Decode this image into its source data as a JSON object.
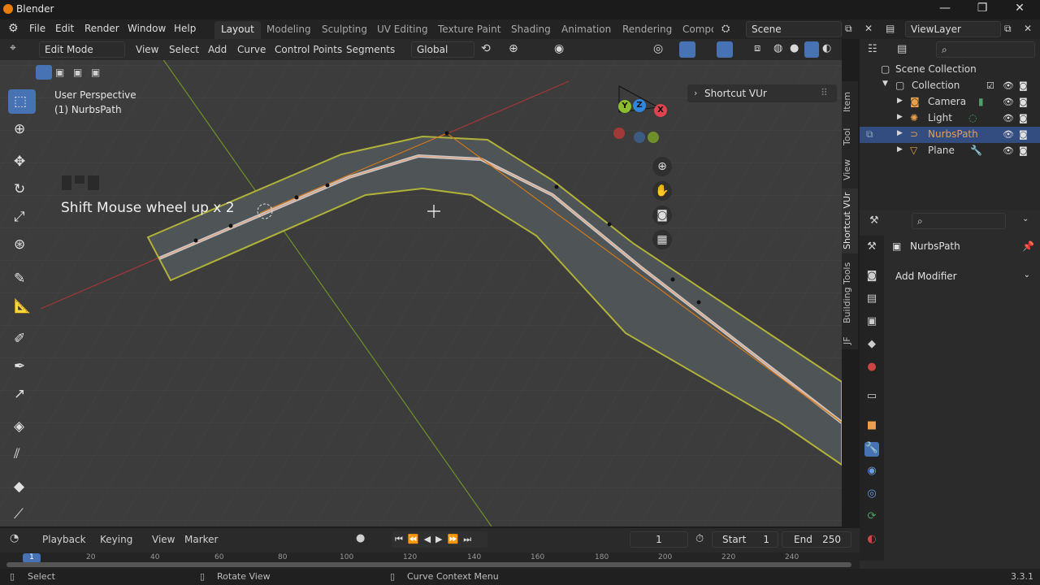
{
  "window": {
    "title": "Blender",
    "controls": [
      "—",
      "❐",
      "✕"
    ]
  },
  "menu": {
    "items": [
      "File",
      "Edit",
      "Render",
      "Window",
      "Help"
    ]
  },
  "workspaces": {
    "tabs": [
      "Layout",
      "Modeling",
      "Sculpting",
      "UV Editing",
      "Texture Paint",
      "Shading",
      "Animation",
      "Rendering",
      "Compo"
    ],
    "active": "Layout"
  },
  "scene": {
    "name": "Scene"
  },
  "viewlayer": {
    "name": "ViewLayer"
  },
  "header": {
    "mode": "Edit Mode",
    "menus": [
      "View",
      "Select",
      "Add",
      "Curve",
      "Control Points",
      "Segments"
    ],
    "transform": "Global"
  },
  "viewport": {
    "perspective": "User Perspective",
    "object": "(1) NurbsPath",
    "overlay_text": "Shift Mouse wheel up x 2",
    "panel": "Shortcut VUr",
    "gizmo": {
      "x": "X",
      "y": "Y",
      "z": "Z"
    }
  },
  "sidebar_tabs": [
    "Item",
    "Tool",
    "View",
    "Shortcut VUr",
    "Building Tools",
    "JF"
  ],
  "outliner": {
    "root": "Scene Collection",
    "collection": "Collection",
    "items": [
      "Camera",
      "Light",
      "NurbsPath",
      "Plane"
    ],
    "selected": "NurbsPath"
  },
  "properties": {
    "object": "NurbsPath",
    "add_modifier": "Add Modifier"
  },
  "timeline": {
    "menus": [
      "Playback",
      "Keying",
      "View",
      "Marker"
    ],
    "current": "1",
    "start_label": "Start",
    "start": "1",
    "end_label": "End",
    "end": "250",
    "ticks": [
      "1",
      "20",
      "40",
      "60",
      "80",
      "100",
      "120",
      "140",
      "160",
      "180",
      "200",
      "220",
      "240"
    ]
  },
  "status": {
    "left": "Select",
    "middle": "Rotate View",
    "right": "Curve Context Menu",
    "version": "3.3.1"
  },
  "colors": {
    "accent": "#4772b3",
    "selected": "#334d80",
    "orange": "#e87d0d"
  }
}
